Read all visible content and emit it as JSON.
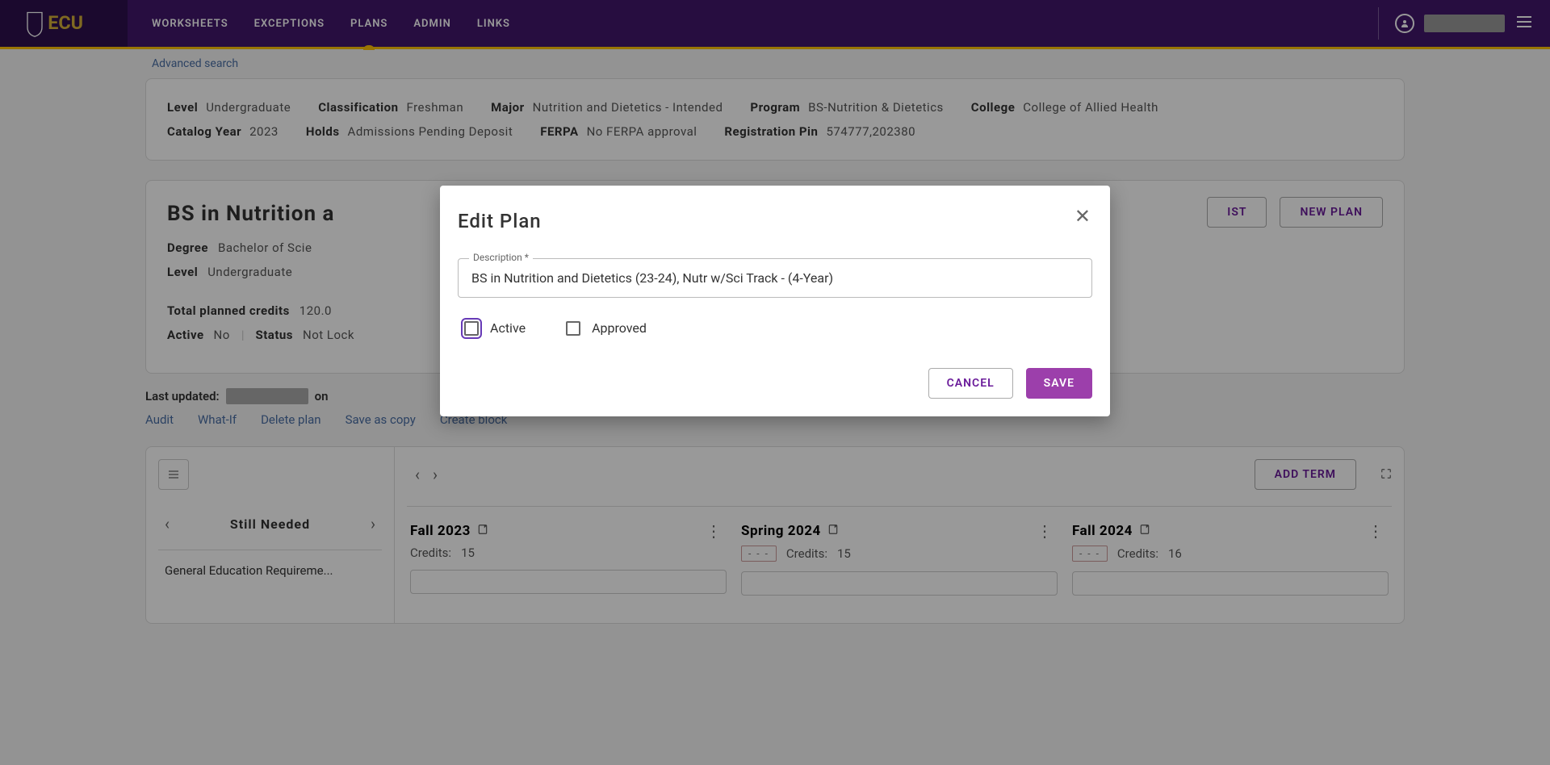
{
  "header": {
    "logo_text": "ECU",
    "nav": [
      "WORKSHEETS",
      "EXCEPTIONS",
      "PLANS",
      "ADMIN",
      "LINKS"
    ],
    "active_nav_index": 2
  },
  "adv_search": "Advanced search",
  "student_info": {
    "row1": [
      {
        "label": "Level",
        "value": "Undergraduate"
      },
      {
        "label": "Classification",
        "value": "Freshman"
      },
      {
        "label": "Major",
        "value": "Nutrition and Dietetics - Intended"
      },
      {
        "label": "Program",
        "value": "BS-Nutrition & Dietetics"
      },
      {
        "label": "College",
        "value": "College of Allied Health"
      }
    ],
    "row2": [
      {
        "label": "Catalog Year",
        "value": "2023"
      },
      {
        "label": "Holds",
        "value": "Admissions Pending Deposit"
      },
      {
        "label": "FERPA",
        "value": "No FERPA approval"
      },
      {
        "label": "Registration Pin",
        "value": "574777,202380"
      }
    ]
  },
  "plan": {
    "title_partial": "BS in Nutrition a",
    "degree_label": "Degree",
    "degree_value_partial": "Bachelor of Scie",
    "level_label": "Level",
    "level_value": "Undergraduate",
    "credits_label": "Total planned credits",
    "credits_value": "120.0",
    "active_label": "Active",
    "active_value": "No",
    "status_label": "Status",
    "status_value_partial": "Not Lock",
    "buttons": {
      "view_list": "IST",
      "new_plan": "NEW PLAN"
    }
  },
  "last_updated": {
    "label": "Last updated:",
    "trailing": "on"
  },
  "action_links": [
    "Audit",
    "What-If",
    "Delete plan",
    "Save as copy",
    "Create block"
  ],
  "sidebar": {
    "still_needed": "Still Needed",
    "req_item": "General Education Requireme..."
  },
  "terms": {
    "add_term": "ADD TERM",
    "cols": [
      {
        "name": "Fall 2023",
        "credits_label": "Credits:",
        "credits_value": "15",
        "has_badge": false
      },
      {
        "name": "Spring 2024",
        "credits_label": "Credits:",
        "credits_value": "15",
        "has_badge": true,
        "badge": "- - -"
      },
      {
        "name": "Fall 2024",
        "credits_label": "Credits:",
        "credits_value": "16",
        "has_badge": true,
        "badge": "- - -"
      }
    ]
  },
  "modal": {
    "title": "Edit Plan",
    "desc_label": "Description *",
    "desc_value": "BS in Nutrition and Dietetics (23-24), Nutr w/Sci Track - (4-Year)",
    "active_label": "Active",
    "approved_label": "Approved",
    "cancel": "CANCEL",
    "save": "SAVE"
  }
}
